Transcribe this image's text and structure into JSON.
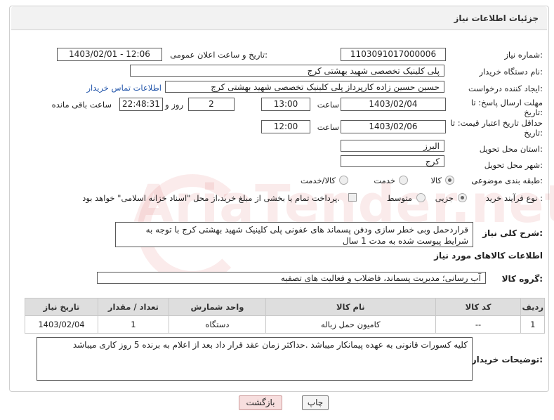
{
  "header": {
    "title": "جزئیات اطلاعات نیاز"
  },
  "form": {
    "need_number_label": "شماره نیاز:",
    "need_number": "1103091017000006",
    "announce_label": "تاریخ و ساعت اعلان عمومی:",
    "announce_value": "1403/02/01 - 12:06",
    "buyer_org_label": "نام دستگاه خریدار:",
    "buyer_org": "پلی کلینیک تخصصی شهید بهشتی کرج",
    "creator_label": "ایجاد کننده درخواست:",
    "creator": "حسین حسین زاده کارپرداز پلی کلینیک تخصصی شهید بهشتی کرج",
    "contact_link": "اطلاعات تماس خریدار",
    "reply_deadline_label_1": "مهلت ارسال پاسخ: تا",
    "reply_deadline_label_2": "تاریخ:",
    "reply_date": "1403/02/04",
    "time_label": "ساعت",
    "reply_time": "13:00",
    "days_value": "2",
    "days_label": "روز و",
    "remaining_time": "22:48:31",
    "remaining_label": "ساعت باقی مانده",
    "price_validity_label_1": "حداقل تاریخ اعتبار قیمت: تا",
    "price_validity_label_2": "تاریخ:",
    "price_date": "1403/02/06",
    "price_time_label": "ساعت",
    "price_time": "12:00",
    "province_label": "استان محل تحویل:",
    "province": "البرز",
    "city_label": "شهر محل تحویل:",
    "city": "کرج",
    "category_label": "طبقه بندی موضوعی:",
    "category_options": [
      "کالا",
      "خدمت",
      "کالا/خدمت"
    ],
    "category_selected": "کالا",
    "purchase_type_label": "نوع فرآیند خرید :",
    "purchase_options": [
      "جزیی",
      "متوسط"
    ],
    "purchase_selected": "جزیی",
    "payment_note": "پرداخت تمام یا بخشی از مبلغ خرید،از محل \"اسناد خزانه اسلامی\" خواهد بود."
  },
  "description": {
    "label": "شرح کلی نیاز:",
    "text": "قراردحمل وبی خطر سازی ودفن پسماند های عفونی پلی کلینیک شهید بهشتی کرج با توجه به شرایط پیوست شده به مدت 1 سال"
  },
  "goods_section": {
    "title": "اطلاعات کالاهای مورد نیاز",
    "group_label": "گروه کالا:",
    "group_value": "آب رسانی؛ مدیریت پسماند، فاضلاب و فعالیت های تصفیه"
  },
  "table": {
    "headers": [
      "ردیف",
      "کد کالا",
      "نام کالا",
      "واحد شمارش",
      "تعداد / مقدار",
      "تاریخ نیاز"
    ],
    "rows": [
      [
        "1",
        "--",
        "کامیون حمل زباله",
        "دستگاه",
        "1",
        "1403/02/04"
      ]
    ]
  },
  "buyer_notes": {
    "label": "توضیحات خریدار:",
    "text": "کلیه کسورات قانونی به عهده پیمانکار میباشد .حداکثر زمان عقد قرار داد بعد از اعلام به برنده 5 روز کاری میباشد"
  },
  "buttons": {
    "print": "چاپ",
    "back": "بازگشت"
  },
  "watermark_text": "AriaTender.net",
  "colors": {
    "link": "#2255aa",
    "back_button_bg": "#f7dede",
    "header_bg": "#dedede"
  }
}
